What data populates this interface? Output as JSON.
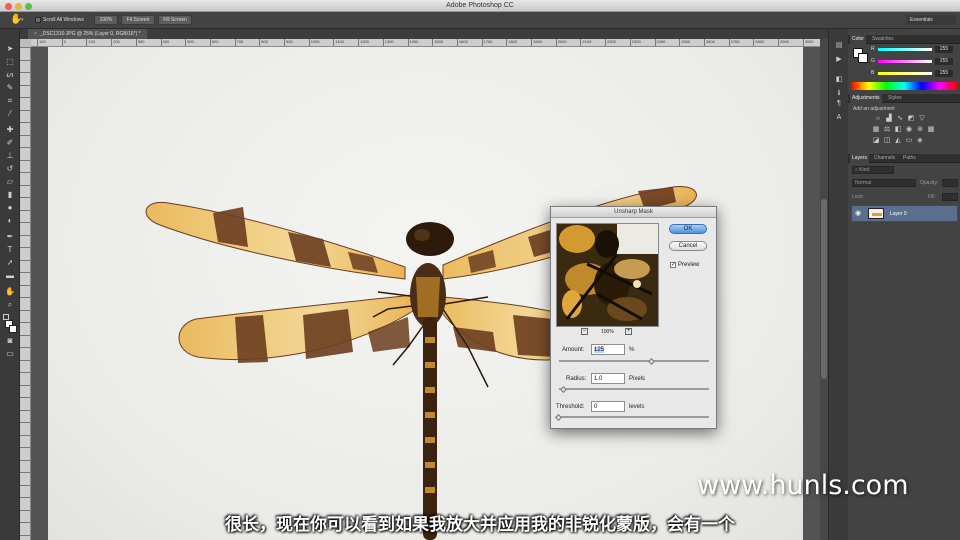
{
  "window": {
    "title": "Adobe Photoshop CC",
    "traffic_lights": [
      "#ec5f57",
      "#e3b33d",
      "#5bbe44"
    ]
  },
  "options_bar": {
    "scroll_all_windows_label": "Scroll All Windows",
    "zoom_100_label": "100%",
    "fit_screen_label": "Fit Screen",
    "fill_screen_label": "Fill Screen",
    "workspace_label": "Essentials"
  },
  "document": {
    "tab_label": "_DSC1310.JPG @ 25% (Layer 0, RGB/16*) *"
  },
  "ruler": {
    "h_labels": [
      "100",
      "0",
      "100",
      "200",
      "300",
      "400",
      "500",
      "600",
      "700",
      "800",
      "900",
      "1000",
      "1100",
      "1200",
      "1300",
      "1400",
      "1500",
      "1600",
      "1700",
      "1800",
      "1900",
      "2000",
      "2100",
      "2200",
      "2300",
      "2400",
      "2500",
      "2600",
      "2700",
      "2800",
      "2900",
      "3000",
      "3100",
      "3200",
      "3300",
      "3400",
      "3500",
      "3600",
      "3700",
      "3800",
      "3900",
      "4000",
      "4100",
      "4200",
      "4300"
    ]
  },
  "panels": {
    "color": {
      "tabs": [
        "Color",
        "Swatches"
      ],
      "channels": [
        {
          "label": "R",
          "value": "255"
        },
        {
          "label": "G",
          "value": "255"
        },
        {
          "label": "B",
          "value": "255"
        }
      ]
    },
    "adjustments": {
      "tabs": [
        "Adjustments",
        "Styles"
      ],
      "hint": "Add an adjustment"
    },
    "layers": {
      "tabs": [
        "Layers",
        "Channels",
        "Paths"
      ],
      "kind_label": "Kind",
      "blend_mode": "Normal",
      "opacity_label": "Opacity:",
      "lock_label": "Lock:",
      "fill_label": "Fill:",
      "layer_name": "Layer 0"
    }
  },
  "dialog": {
    "title": "Unsharp Mask",
    "ok_label": "OK",
    "cancel_label": "Cancel",
    "preview_label": "Preview",
    "zoom_label": "100%",
    "zoom_out_glyph": "−",
    "zoom_in_glyph": "+",
    "amount_label": "Amount:",
    "amount_value": "125",
    "amount_unit": "%",
    "radius_label": "Radius:",
    "radius_value": "1.0",
    "radius_unit": "Pixels",
    "threshold_label": "Threshold:",
    "threshold_value": "0",
    "threshold_unit": "levels",
    "amount_level": 0.62,
    "radius_level": 0.03,
    "threshold_level": 0.0
  },
  "overlay": {
    "subtitle": "很长，现在你可以看到如果我放大并应用我的非锐化蒙版，会有一个",
    "watermark": "www.hunls.com"
  },
  "colors": {
    "accent_blue": "#4f93e0",
    "wing_amber": "#e9b145",
    "wing_band": "#6b3d1f"
  }
}
